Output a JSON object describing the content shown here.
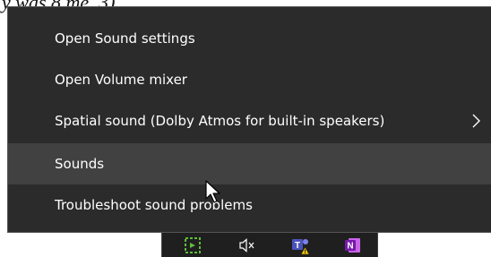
{
  "background_note": "y was 8 me, 3)",
  "menu": {
    "items": [
      {
        "label": "Open Sound settings"
      },
      {
        "label": "Open Volume mixer"
      },
      {
        "label": "Spatial sound (Dolby Atmos for built-in speakers)",
        "has_submenu": true
      },
      {
        "label": "Sounds",
        "highlighted": true
      },
      {
        "label": "Troubleshoot sound problems"
      }
    ]
  },
  "tray": {
    "icons": [
      "green-app-icon",
      "speaker-muted-icon",
      "teams-warning-icon",
      "onenote-icon"
    ]
  },
  "colors": {
    "menu_bg": "#2b2b2b",
    "hover_bg": "#414141",
    "text": "#ffffff",
    "teams": "#4b53bc",
    "onenote": "#7719aa",
    "warning": "#f5c400",
    "green": "#5fbf3a"
  }
}
